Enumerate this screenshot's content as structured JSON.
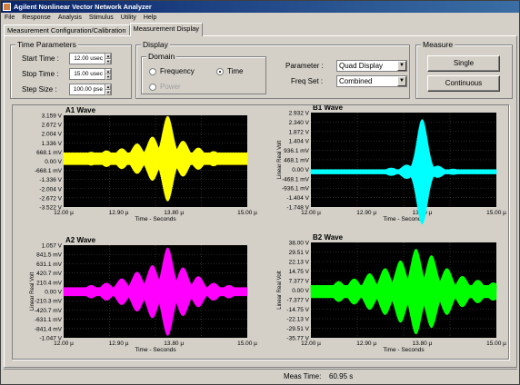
{
  "window": {
    "title": "Agilent Nonlinear Vector Network Analyzer"
  },
  "menu": [
    "File",
    "Response",
    "Analysis",
    "Stimulus",
    "Utility",
    "Help"
  ],
  "tabs": [
    {
      "label": "Measurement Configuration/Calibration",
      "active": false
    },
    {
      "label": "Measurement Display",
      "active": true
    }
  ],
  "time_params": {
    "title": "Time Parameters",
    "start_label": "Start Time :",
    "start_value": "12.00 usec",
    "stop_label": "Stop Time :",
    "stop_value": "15.00 usec",
    "step_label": "Step Size :",
    "step_value": "100.00 pse"
  },
  "display": {
    "title": "Display",
    "domain_title": "Domain",
    "frequency_label": "Frequency",
    "time_label": "Time",
    "power_label": "Power",
    "selected_domain": "Time",
    "parameter_label": "Parameter :",
    "parameter_value": "Quad Display",
    "freqset_label": "Freq Set :",
    "freqset_value": "Combined"
  },
  "measure": {
    "title": "Measure",
    "single_label": "Single",
    "continuous_label": "Continuous"
  },
  "status": {
    "meas_time_label": "Meas Time:",
    "meas_time_value": "60.95 s"
  },
  "chart_data": [
    {
      "type": "line",
      "title": "A1 Wave",
      "xlabel": "Time - Seconds",
      "ylabel": "",
      "xticks": [
        "12.00 µ",
        "12.90 µ",
        "13.80 µ",
        "15.00 µ"
      ],
      "yticks": [
        "3.159 V",
        "2.672 V",
        "2.004 V",
        "1.336 V",
        "668.1 mV",
        "0.00 V",
        "-668.1 mV",
        "-1.336 V",
        "-2.004 V",
        "-2.672 V",
        "-3.522 V"
      ],
      "xlim": [
        12.0,
        15.0
      ],
      "ylim": [
        -3.522,
        3.159
      ],
      "color": "#ffff00",
      "envelope": {
        "baseline": 0.45,
        "bursts": [
          [
            12.45,
            0.5
          ],
          [
            12.7,
            0.6
          ],
          [
            12.95,
            0.75
          ],
          [
            13.2,
            1.1
          ],
          [
            13.45,
            1.6
          ],
          [
            13.7,
            3.1
          ],
          [
            13.95,
            1.3
          ],
          [
            14.2,
            0.8
          ],
          [
            14.45,
            0.55
          ],
          [
            14.7,
            0.45
          ]
        ]
      }
    },
    {
      "type": "line",
      "title": "B1 Wave",
      "xlabel": "Time - Seconds",
      "ylabel": "Linear Real Volt",
      "xticks": [
        "12.00 µ",
        "12.90 µ",
        "13.80 µ",
        "15.00 µ"
      ],
      "yticks": [
        "2.932 V",
        "2.340 V",
        "1.872 V",
        "1.404 V",
        "936.1 mV",
        "468.1 mV",
        "0.00 V",
        "-468.1 mV",
        "-936.1 mV",
        "-1.404 V",
        "-1.748 V"
      ],
      "xlim": [
        12.0,
        15.0
      ],
      "ylim": [
        -1.748,
        2.932
      ],
      "color": "#00ffff",
      "envelope": {
        "baseline": 0.12,
        "bursts": [
          [
            13.3,
            0.2
          ],
          [
            13.55,
            0.35
          ],
          [
            13.8,
            2.6
          ],
          [
            14.05,
            0.3
          ],
          [
            14.3,
            0.15
          ]
        ]
      }
    },
    {
      "type": "line",
      "title": "A2 Wave",
      "xlabel": "Time - Seconds",
      "ylabel": "Linear Real Volt",
      "xticks": [
        "12.00 µ",
        "12.90 µ",
        "13.80 µ",
        "15.00 µ"
      ],
      "yticks": [
        "1.057 V",
        "841.5 mV",
        "631.1 mV",
        "420.7 mV",
        "210.4 mV",
        "0.00 V",
        "-210.3 mV",
        "-420.7 mV",
        "-631.1 mV",
        "-841.4 mV",
        "-1.047 V"
      ],
      "xlim": [
        12.0,
        15.0
      ],
      "ylim": [
        -1.047,
        1.057
      ],
      "color": "#ff00ff",
      "envelope": {
        "baseline": 0.1,
        "bursts": [
          [
            12.2,
            0.1
          ],
          [
            12.45,
            0.15
          ],
          [
            12.7,
            0.2
          ],
          [
            12.95,
            0.3
          ],
          [
            13.2,
            0.45
          ],
          [
            13.45,
            0.6
          ],
          [
            13.7,
            1.0
          ],
          [
            13.95,
            0.55
          ],
          [
            14.2,
            0.35
          ],
          [
            14.45,
            0.2
          ],
          [
            14.7,
            0.15
          ],
          [
            14.95,
            0.1
          ]
        ]
      }
    },
    {
      "type": "line",
      "title": "B2 Wave",
      "xlabel": "Time - Seconds",
      "ylabel": "Linear Real Volt",
      "xticks": [
        "12.00 µ",
        "12.90 µ",
        "13.80 µ",
        "15.00 µ"
      ],
      "yticks": [
        "38.00 V",
        "29.51 V",
        "22.13 V",
        "14.75 V",
        "7.377 V",
        "0.00 V",
        "-7.377 V",
        "-14.75 V",
        "-22.13 V",
        "-29.51 V",
        "-35.77 V"
      ],
      "xlim": [
        12.0,
        15.0
      ],
      "ylim": [
        -35.77,
        38.0
      ],
      "color": "#00ff00",
      "envelope": {
        "baseline": 5.0,
        "bursts": [
          [
            12.2,
            5
          ],
          [
            12.45,
            8
          ],
          [
            12.7,
            10
          ],
          [
            12.95,
            14
          ],
          [
            13.2,
            18
          ],
          [
            13.45,
            24
          ],
          [
            13.7,
            33
          ],
          [
            13.95,
            28
          ],
          [
            14.2,
            18
          ],
          [
            14.45,
            12
          ],
          [
            14.7,
            9
          ],
          [
            14.95,
            7
          ]
        ]
      }
    }
  ]
}
